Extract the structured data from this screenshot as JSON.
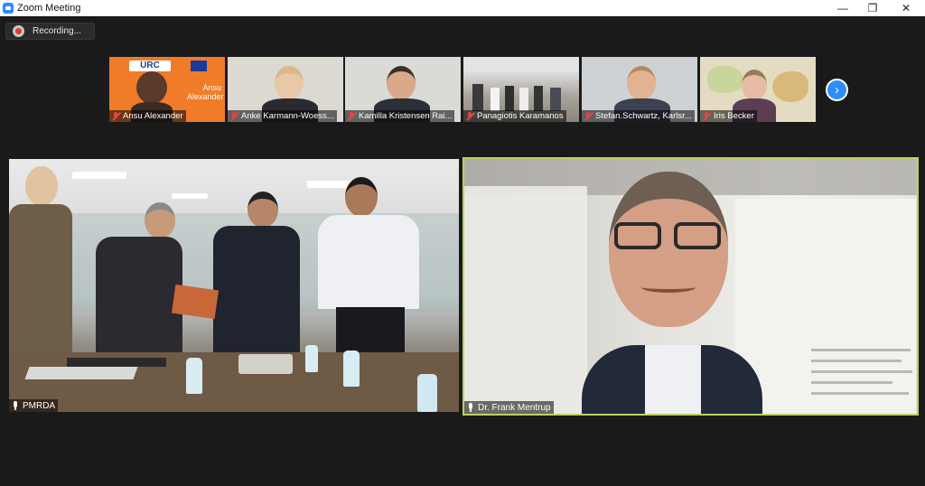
{
  "window": {
    "title": "Zoom Meeting",
    "minimize": "—",
    "maximize": "❐",
    "close": "✕"
  },
  "recording": {
    "label": "Recording..."
  },
  "gallery": {
    "participants": [
      {
        "name": "Ansu Alexander",
        "muted": true,
        "bg": "#f07c2a",
        "logo": "URC",
        "overlay_name": "Ansu\nAlexander"
      },
      {
        "name": "Anke Karmann-Woess...",
        "muted": true,
        "bg": "#d8d5cf"
      },
      {
        "name": "Kamilla Kristensen Rai...",
        "muted": true,
        "bg": "#d9d9d6"
      },
      {
        "name": "Panagiotis Karamanos",
        "muted": true,
        "bg": "#b9b4ad"
      },
      {
        "name": "Stefan.Schwartz, Karlsr...",
        "muted": true,
        "bg": "#c9cdd1"
      },
      {
        "name": "Iris Becker",
        "muted": true,
        "bg": "#d7d0b8"
      }
    ],
    "next_icon": "›"
  },
  "main": {
    "left": {
      "name": "PMRDA",
      "muted": false
    },
    "right": {
      "name": "Dr. Frank Mentrup",
      "muted": false,
      "active_speaker_color": "#b7d45e"
    }
  }
}
